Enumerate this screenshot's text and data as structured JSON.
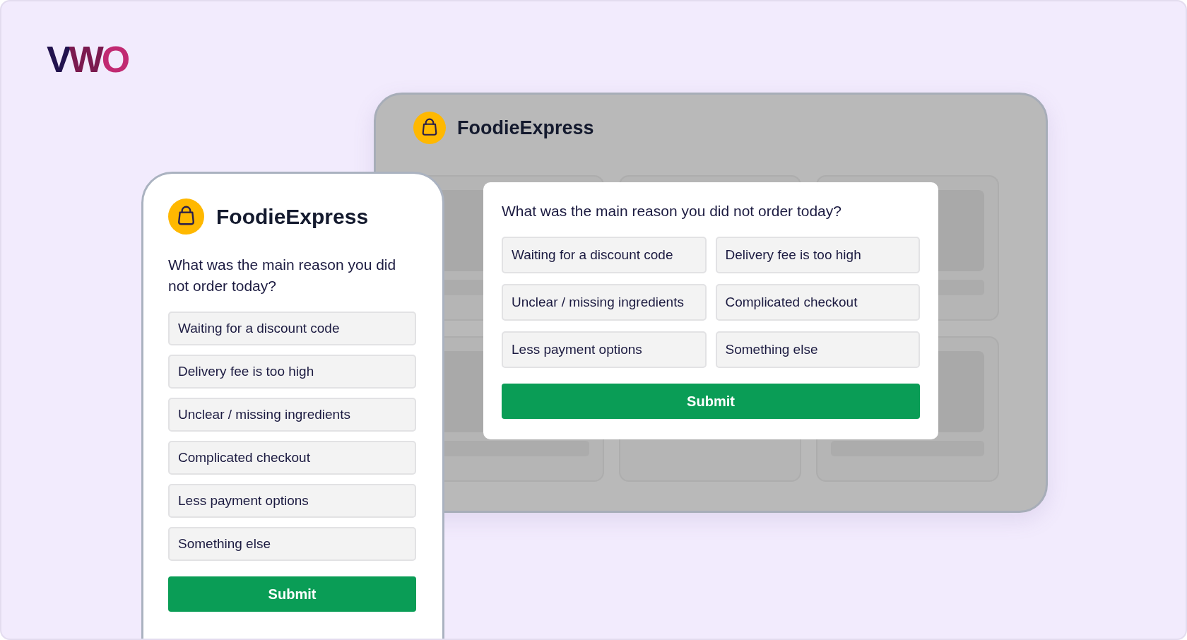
{
  "logo": {
    "text": "VWO"
  },
  "desktop": {
    "brand": "FoodieExpress",
    "survey": {
      "question": "What was the main reason you did not order today?",
      "options": [
        "Waiting for a discount code",
        "Delivery fee is too high",
        "Unclear / missing ingredients",
        "Complicated checkout",
        "Less payment options",
        "Something else"
      ],
      "submit": "Submit"
    }
  },
  "mobile": {
    "brand": "FoodieExpress",
    "survey": {
      "question": "What was the main reason you did not order today?",
      "options": [
        "Waiting for a discount code",
        "Delivery fee is too high",
        "Unclear / missing ingredients",
        "Complicated checkout",
        "Less payment options",
        "Something else"
      ],
      "submit": "Submit"
    }
  }
}
